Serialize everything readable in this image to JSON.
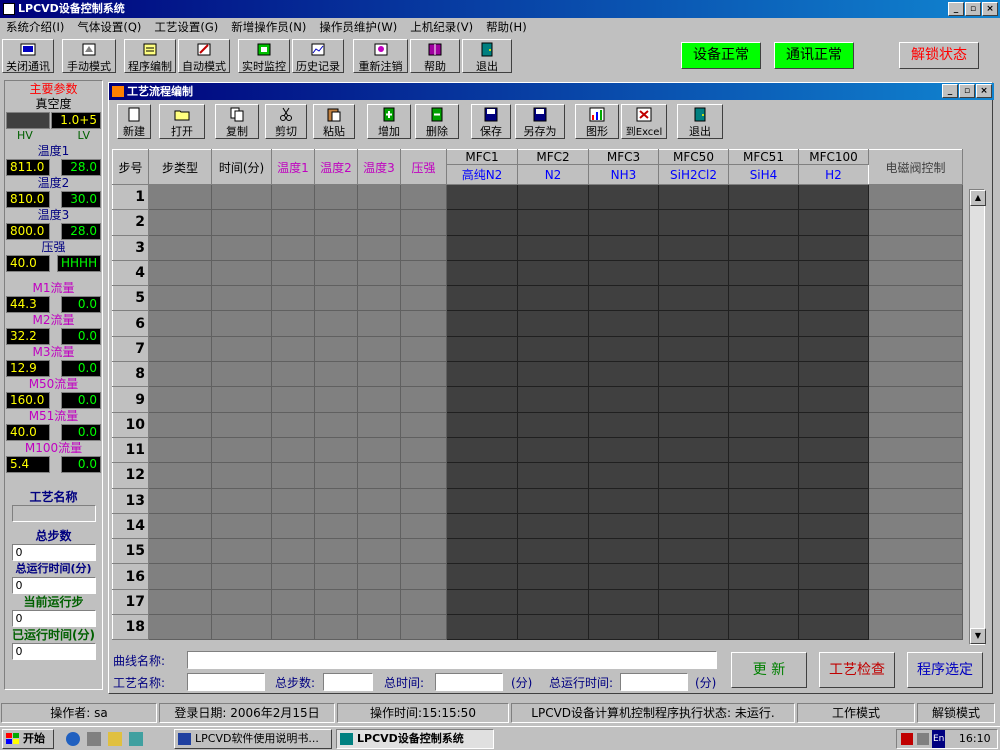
{
  "window": {
    "title": "LPCVD设备控制系统",
    "controls": [
      "_",
      "▫",
      "×"
    ]
  },
  "menu": [
    "系统介绍(I)",
    "气体设置(Q)",
    "工艺设置(G)",
    "新增操作员(N)",
    "操作员维护(W)",
    "上机纪录(V)",
    "帮助(H)"
  ],
  "toolbar": {
    "buttons": [
      "关闭通讯",
      "手动模式",
      "程序编制",
      "自动模式",
      "实时监控",
      "历史记录",
      "重新注销",
      "帮助",
      "退出"
    ],
    "status_device": "设备正常",
    "status_comm": "通讯正常",
    "unlock": "解锁状态"
  },
  "left_panel": {
    "title": "主要参数",
    "vacuum_label": "真空度",
    "vacuum_value": "1.0+5",
    "hv": "HV",
    "lv": "LV",
    "temp1_label": "温度1",
    "temp1_set": "811.0",
    "temp1_act": "28.0",
    "temp2_label": "温度2",
    "temp2_set": "810.0",
    "temp2_act": "30.0",
    "temp3_label": "温度3",
    "temp3_set": "800.0",
    "temp3_act": "28.0",
    "pressure_label": "压强",
    "pressure_set": "40.0",
    "pressure_act": "HHHH",
    "m1_label": "M1流量",
    "m1_set": "44.3",
    "m1_act": "0.0",
    "m2_label": "M2流量",
    "m2_set": "32.2",
    "m2_act": "0.0",
    "m3_label": "M3流量",
    "m3_set": "12.9",
    "m3_act": "0.0",
    "m50_label": "M50流量",
    "m50_set": "160.0",
    "m50_act": "0.0",
    "m51_label": "M51流量",
    "m51_set": "40.0",
    "m51_act": "0.0",
    "m100_label": "M100流量",
    "m100_set": "5.4",
    "m100_act": "0.0",
    "process_name_label": "工艺名称",
    "process_name_value": "",
    "total_steps_label": "总步数",
    "total_steps_value": "0",
    "total_run_time_label": "总运行时间(分)",
    "total_run_time_value": "0",
    "current_step_label": "当前运行步",
    "current_step_value": "0",
    "elapsed_label": "已运行时间(分)",
    "elapsed_value": "0"
  },
  "child_window": {
    "title": "工艺流程编制",
    "buttons": [
      "新建",
      "打开",
      "复制",
      "剪切",
      "粘贴",
      "增加",
      "删除",
      "保存",
      "另存为",
      "图形",
      "到Excel",
      "退出"
    ]
  },
  "grid": {
    "col_step": "步号",
    "col_type": "步类型",
    "col_time": "时间(分)",
    "col_t1": "温度1",
    "col_t2": "温度2",
    "col_t3": "温度3",
    "col_p": "压强",
    "mfc": [
      {
        "id": "MFC1",
        "gas": "高纯N2"
      },
      {
        "id": "MFC2",
        "gas": "N2"
      },
      {
        "id": "MFC3",
        "gas": "NH3"
      },
      {
        "id": "MFC50",
        "gas": "SiH2Cl2"
      },
      {
        "id": "MFC51",
        "gas": "SiH4"
      },
      {
        "id": "MFC100",
        "gas": "H2"
      }
    ],
    "col_valve": "电磁阀控制",
    "rows": [
      "1",
      "2",
      "3",
      "4",
      "5",
      "6",
      "7",
      "8",
      "9",
      "10",
      "11",
      "12",
      "13",
      "14",
      "15",
      "16",
      "17",
      "18"
    ]
  },
  "bottom_form": {
    "curve_name_label": "曲线名称:",
    "curve_name_value": "",
    "process_name_label": "工艺名称:",
    "process_name_value": "",
    "total_steps_label": "总步数:",
    "total_steps_value": "",
    "total_time_label": "总时间:",
    "total_time_value": "",
    "min1": "(分)",
    "total_run_label": "总运行时间:",
    "total_run_value": "",
    "min2": "(分)",
    "update_btn": "更 新",
    "check_btn": "工艺检查",
    "select_btn": "程序选定"
  },
  "status_bar": {
    "operator": "操作者: sa",
    "login_date": "登录日期: 2006年2月15日",
    "op_time": "操作时间:15:15:50",
    "run_status": "LPCVD设备计算机控制程序执行状态: 未运行.",
    "mode": "工作模式",
    "unlock_mode": "解锁模式"
  },
  "taskbar": {
    "start": "开始",
    "task1": "LPCVD软件使用说明书...",
    "task2": "LPCVD设备控制系统",
    "lang": "En",
    "clock": "16:10"
  }
}
